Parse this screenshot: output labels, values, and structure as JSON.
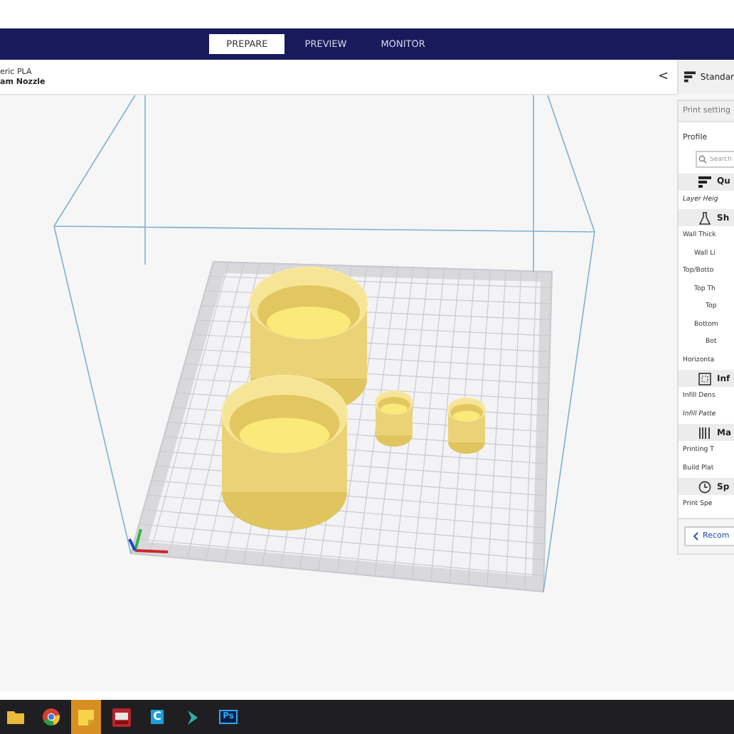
{
  "tabs": [
    {
      "label": "PREPARE",
      "selected": true
    },
    {
      "label": "PREVIEW",
      "selected": false
    },
    {
      "label": "MONITOR",
      "selected": false
    }
  ],
  "printer": {
    "material": "eric PLA",
    "nozzle": "am Nozzle"
  },
  "collapse_button": "<",
  "profile_button": {
    "label": "Standar"
  },
  "settings_panel": {
    "title": "Print setting",
    "profile_label": "Profile",
    "search": {
      "placeholder": "Search"
    },
    "items": [
      {
        "kind": "section",
        "label": "Qu"
      },
      {
        "kind": "setting",
        "label": "Layer Heig",
        "italic": true
      },
      {
        "kind": "section",
        "label": "Sh"
      },
      {
        "kind": "setting",
        "label": "Wall Thick",
        "italic": false,
        "children": [
          {
            "label": "Wall Li",
            "italic": false
          }
        ]
      },
      {
        "kind": "setting",
        "label": "Top/Botto",
        "italic": false,
        "children": [
          {
            "label": "Top Th",
            "italic": false,
            "children": [
              {
                "label": "Top",
                "italic": false
              }
            ]
          },
          {
            "label": "Bottom",
            "italic": false,
            "children": [
              {
                "label": "Bot",
                "italic": false
              }
            ]
          }
        ]
      },
      {
        "kind": "setting",
        "label": "Horizonta",
        "italic": false
      },
      {
        "kind": "section",
        "label": "Inf"
      },
      {
        "kind": "setting",
        "label": "Infill Dens",
        "italic": false
      },
      {
        "kind": "setting",
        "label": "Infill Patte",
        "italic": true
      },
      {
        "kind": "section",
        "label": "Ma"
      },
      {
        "kind": "setting",
        "label": "Printing T",
        "italic": false
      },
      {
        "kind": "setting",
        "label": "Build Plat",
        "italic": false
      },
      {
        "kind": "section",
        "label": "Sp"
      },
      {
        "kind": "setting",
        "label": "Print Spe",
        "italic": false
      }
    ],
    "footer_button": {
      "label": "Recom"
    }
  },
  "taskbar": [
    {
      "kind": "folder",
      "selected": false
    },
    {
      "kind": "chrome",
      "selected": false
    },
    {
      "kind": "notes",
      "selected": true
    },
    {
      "kind": "red-app",
      "selected": false
    },
    {
      "kind": "letter",
      "label": "C",
      "selected": false
    },
    {
      "kind": "arrow",
      "selected": false
    },
    {
      "kind": "letter",
      "label": "Ps",
      "selected": false
    }
  ]
}
